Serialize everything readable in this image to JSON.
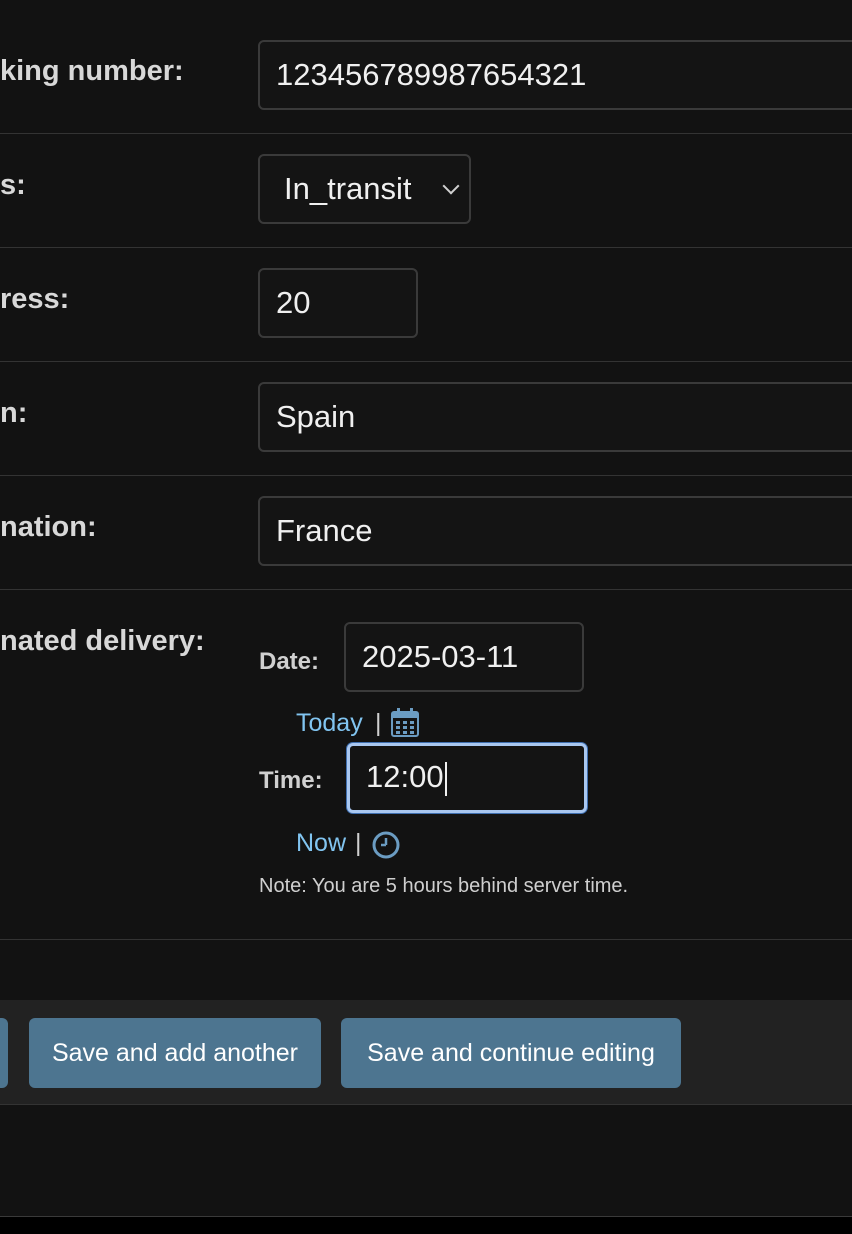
{
  "form": {
    "tracking_number": {
      "label": "king number:",
      "value": "12345678998765432​1"
    },
    "status": {
      "label": "s:",
      "value": "In_transit"
    },
    "progress": {
      "label": "ress:",
      "value": "20"
    },
    "origin": {
      "label": "n:",
      "value": "Spain"
    },
    "destination": {
      "label": "nation:",
      "value": "France"
    },
    "estimated_delivery": {
      "label": "nated delivery:",
      "date_label": "Date:",
      "date_value": "2025-03-11",
      "today_link": "Today",
      "separator": "|",
      "time_label": "Time:",
      "time_value": "12:00",
      "now_link": "Now",
      "note": "Note: You are 5 hours behind server time."
    }
  },
  "actions": {
    "save_add_another": "Save and add another",
    "save_continue": "Save and continue editing"
  },
  "colors": {
    "background": "#121212",
    "button": "#4d7590",
    "link": "#81c4f0",
    "focus_border": "#a9c7f0"
  }
}
